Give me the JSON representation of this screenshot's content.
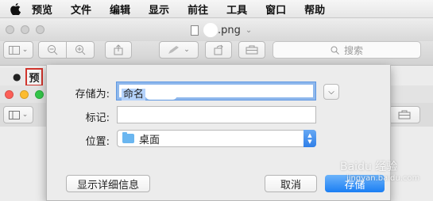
{
  "menubar": {
    "apple_icon": "apple-logo-icon",
    "items": [
      "预览",
      "文件",
      "编辑",
      "显示",
      "前往",
      "工具",
      "窗口",
      "帮助"
    ]
  },
  "back_menubar": {
    "highlighted_item": "预"
  },
  "window": {
    "title": ".png",
    "traffic_lights": {
      "close": "#fc5f57",
      "minimize": "#fdbc2e",
      "zoom": "#34c84a"
    }
  },
  "toolbar": {
    "search_placeholder": "搜索"
  },
  "save_sheet": {
    "save_as_label": "存储为:",
    "name_value": "命名",
    "tags_label": "标记:",
    "tags_value": "",
    "location_label": "位置:",
    "location_value": "桌面",
    "details_button": "显示详细信息",
    "cancel_button": "取消",
    "save_button": "存储"
  },
  "watermark": {
    "line1": "Baidu 经验",
    "line2": "jingyan.baidu.com"
  },
  "colors": {
    "accent": "#1b7ef3",
    "highlight_border": "#d0342c"
  }
}
